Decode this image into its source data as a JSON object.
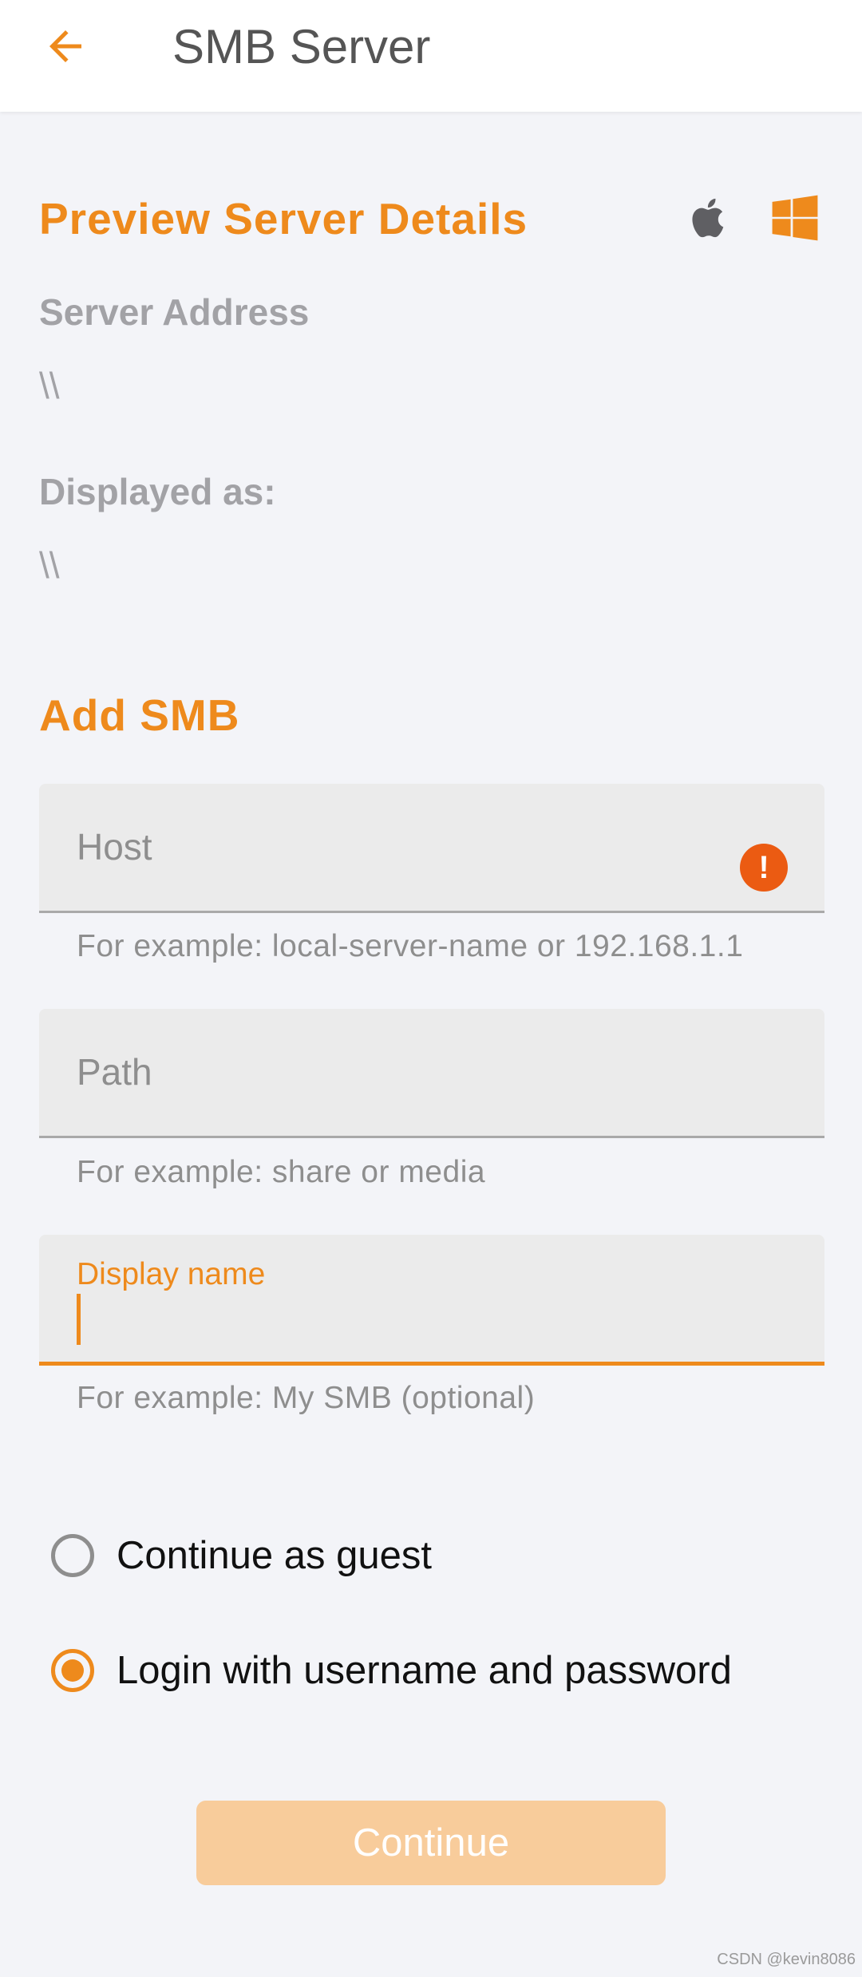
{
  "appbar": {
    "title": "SMB Server",
    "back_icon": "arrow-left-icon"
  },
  "preview": {
    "title": "Preview Server Details",
    "icons": [
      "apple-icon",
      "windows-icon"
    ],
    "server_address_label": "Server Address",
    "server_address_value": "\\\\",
    "displayed_as_label": "Displayed as:",
    "displayed_as_value": "\\\\"
  },
  "add_smb": {
    "title": "Add SMB",
    "host": {
      "placeholder": "Host",
      "helper": "For example: local-server-name or 192.168.1.1",
      "error_icon": "!"
    },
    "path": {
      "placeholder": "Path",
      "helper": "For example: share or media"
    },
    "display_name": {
      "label": "Display name",
      "value": "",
      "helper": "For example: My SMB (optional)"
    }
  },
  "auth_options": [
    {
      "label": "Continue as guest",
      "selected": false
    },
    {
      "label": "Login with username and password",
      "selected": true
    }
  ],
  "continue_button": {
    "label": "Continue",
    "enabled": false
  },
  "watermark": "CSDN @kevin8086",
  "colors": {
    "accent": "#ee8a1c",
    "error": "#eb5b12",
    "disabled_button": "#f8cc9b",
    "background": "#f3f4f8"
  }
}
